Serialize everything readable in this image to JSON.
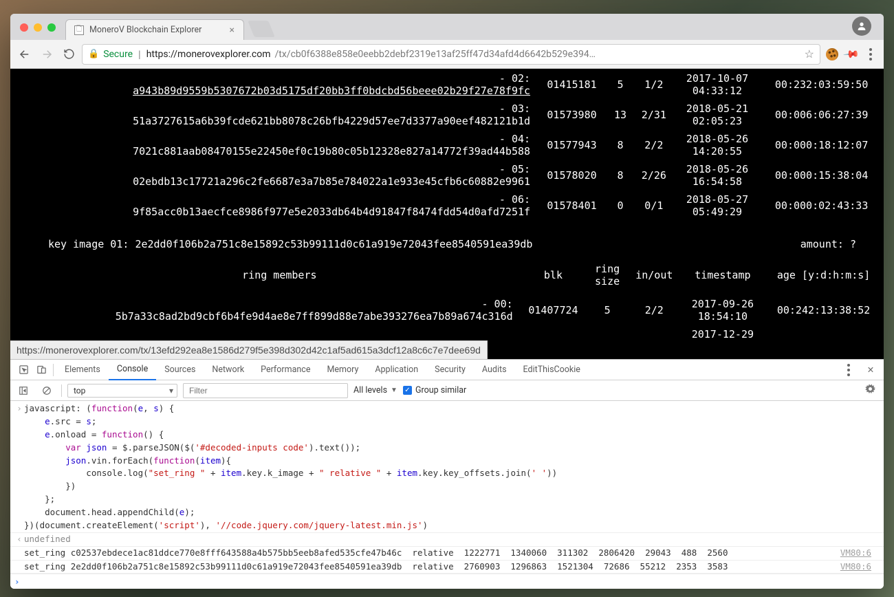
{
  "tab": {
    "title": "MoneroV Blockchain Explorer"
  },
  "addressbar": {
    "secure": "Secure",
    "host": "https://monerovexplorer.com",
    "path": "/tx/cb0f6388e858e0eebb2debf2319e13af25ff47d34afd4d6642b529e394…"
  },
  "url_tooltip": "https://monerovexplorer.com/tx/13efd292ea8e1586d279f5e398d302d42c1af5ad615a3dcf12a8c6c7e7dee69d",
  "ring_rows": [
    {
      "idx": "- 02:",
      "hash": "a943b89d9559b5307672b03d5175df20bb3ff0bdcbd56beee02b29f27e78f9fc",
      "blk": "01415181",
      "rs": "5",
      "io": "1/2",
      "ts_a": "2017-10-07",
      "ts_b": "04:33:12",
      "age": "00:232:03:59:50",
      "u": true
    },
    {
      "idx": "- 03:",
      "hash": "51a3727615a6b39fcde621bb8078c26bfb4229d57ee7d3377a90eef482121b1d",
      "blk": "01573980",
      "rs": "13",
      "io": "2/31",
      "ts_a": "2018-05-21",
      "ts_b": "02:05:23",
      "age": "00:006:06:27:39"
    },
    {
      "idx": "- 04:",
      "hash": "7021c881aab08470155e22450ef0c19b80c05b12328e827a14772f39ad44b588",
      "blk": "01577943",
      "rs": "8",
      "io": "2/2",
      "ts_a": "2018-05-26",
      "ts_b": "14:20:55",
      "age": "00:000:18:12:07"
    },
    {
      "idx": "- 05:",
      "hash": "02ebdb13c17721a296c2fe6687e3a7b85e784022a1e933e45cfb6c60882e9961",
      "blk": "01578020",
      "rs": "8",
      "io": "2/26",
      "ts_a": "2018-05-26",
      "ts_b": "16:54:58",
      "age": "00:000:15:38:04"
    },
    {
      "idx": "- 06:",
      "hash": "9f85acc0b13aecfce8986f977e5e2033db64b4d91847f8474fdd54d0afd7251f",
      "blk": "01578401",
      "rs": "0",
      "io": "0/1",
      "ts_a": "2018-05-27",
      "ts_b": "05:49:29",
      "age": "00:000:02:43:33"
    }
  ],
  "key_image": {
    "label": "key image 01:",
    "hash": "2e2dd0f106b2a751c8e15892c53b99111d0c61a919e72043fee8540591ea39db",
    "amount_label": "amount: ?"
  },
  "headers": {
    "rm": "ring members",
    "blk": "blk",
    "rs": "ring\nsize",
    "io": "in/out",
    "ts": "timestamp",
    "age": "age [y:d:h:m:s]"
  },
  "ring_rows2": [
    {
      "idx": "- 00:",
      "hash": "5b7a33c8ad2bd9cbf6b4fe9d4ae8e7ff899d88e7abe393276ea7b89a674c316d",
      "blk": "01407724",
      "rs": "5",
      "io": "2/2",
      "ts_a": "2017-09-26",
      "ts_b": "18:54:10",
      "age": "00:242:13:38:52"
    }
  ],
  "partial_date": "2017-12-29",
  "devtools": {
    "tabs": [
      "Elements",
      "Console",
      "Sources",
      "Network",
      "Performance",
      "Memory",
      "Application",
      "Security",
      "Audits",
      "EditThisCookie"
    ],
    "active": 1,
    "context": "top",
    "filter_ph": "Filter",
    "levels": "All levels",
    "group": "Group similar",
    "undef": "undefined",
    "src": "VM80:6",
    "log1": "set_ring c02537ebdece1ac81ddce770e8fff643588a4b575bb5eeb8afed535cfe47b46c  relative  1222771  1340060  311302  2806420  29043  488  2560",
    "log2": "set_ring 2e2dd0f106b2a751c8e15892c53b99111d0c61a919e72043fee8540591ea39db  relative  2760903  1296863  1521304  72686  55212  2353  3583"
  }
}
